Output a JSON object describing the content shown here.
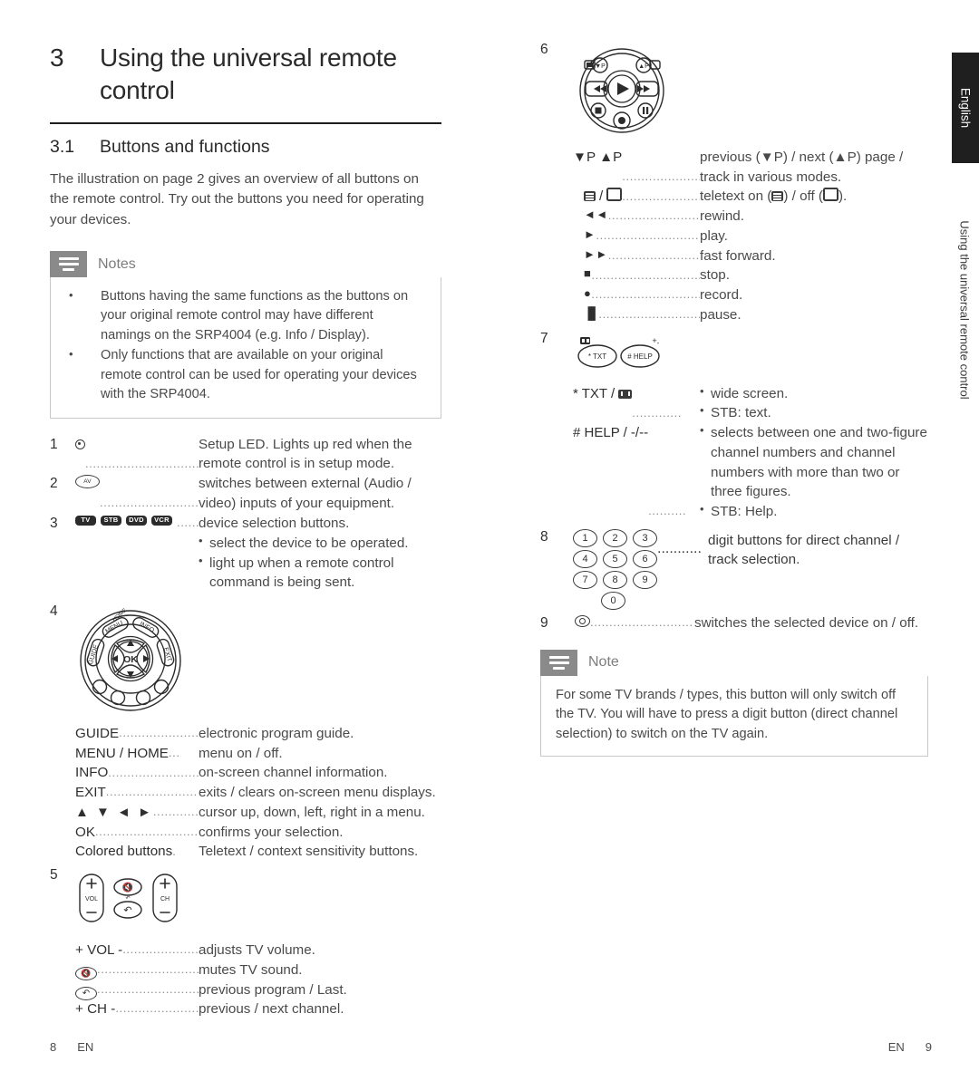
{
  "document": {
    "language_tab": "English",
    "side_caption": "Using the universal remote control"
  },
  "chapter": {
    "number": "3",
    "title": "Using the universal remote control"
  },
  "section": {
    "number": "3.1",
    "title": "Buttons and functions",
    "intro": "The illustration on page 2 gives an overview of all buttons on the remote control. Try out the buttons you need for operating your devices."
  },
  "notes_box": {
    "title": "Notes",
    "items": [
      "Buttons having the same functions as the buttons on your original remote control may have different namings on the SRP4004 (e.g. Info / Display).",
      "Only functions that are available on your original remote control can be used for operating your devices with the SRP4004."
    ]
  },
  "note_box": {
    "title": "Note",
    "text": "For some TV brands / types, this button will only switch off the TV. You will have to press a digit button (direct channel selection) to switch on the TV again."
  },
  "entries": {
    "item1": {
      "index": "1",
      "icon": "setup-led-icon",
      "description": "Setup LED. Lights up red when the remote control is in setup mode."
    },
    "item2": {
      "index": "2",
      "key_label": "AV",
      "description": "switches between external (Audio / video) inputs of your equipment."
    },
    "item3": {
      "index": "3",
      "device_buttons": [
        "TV",
        "STB",
        "DVD",
        "VCR"
      ],
      "description": "device selection buttons.",
      "bullets": [
        "select the device to be operated.",
        "light up when a remote control command is being sent."
      ]
    },
    "item4": {
      "index": "4",
      "pad_labels": [
        "HOME",
        "MENU",
        "INFO",
        "GUIDE",
        "EXIT",
        "OK"
      ],
      "rows": [
        {
          "key": "GUIDE",
          "desc": "electronic program guide."
        },
        {
          "key": "MENU / HOME",
          "desc": "menu on / off."
        },
        {
          "key": "INFO",
          "desc": "on-screen channel information."
        },
        {
          "key": "EXIT",
          "desc": "exits / clears on-screen menu displays."
        },
        {
          "key": "▲ ▼ ◄ ►",
          "desc": "cursor up, down, left, right in a menu."
        },
        {
          "key": "OK",
          "desc": "confirms your selection."
        },
        {
          "key": "Colored buttons",
          "desc": "Teletext / context sensitivity buttons."
        }
      ]
    },
    "item5": {
      "index": "5",
      "pad_labels": [
        "+",
        "VOL",
        "−",
        "+",
        "CH",
        "−"
      ],
      "rows": [
        {
          "key": "+ VOL -",
          "desc": "adjusts TV volume."
        },
        {
          "key": "mute-icon",
          "desc": "mutes TV sound."
        },
        {
          "key": "last-channel-icon",
          "desc": "previous program / Last."
        },
        {
          "key": "+ CH -",
          "desc": "previous / next channel."
        }
      ]
    },
    "item6": {
      "index": "6",
      "rows": [
        {
          "key": "▼P ▲P",
          "desc": "previous (▼P) / next (▲P) page / track in various modes."
        },
        {
          "key": "teletext-on-icon / teletext-off-icon",
          "desc_pre": "teletext on (",
          "desc_mid": ") / off (",
          "desc_post": ")."
        },
        {
          "key": "◄◄",
          "desc": "rewind."
        },
        {
          "key": "►",
          "desc": "play."
        },
        {
          "key": "►►",
          "desc": "fast forward."
        },
        {
          "key": "■",
          "desc": "stop."
        },
        {
          "key": "●",
          "desc": "record."
        },
        {
          "key": "▐▌",
          "desc": "pause."
        }
      ]
    },
    "item7": {
      "index": "7",
      "buttons": [
        "* TXT",
        "# HELP"
      ],
      "rows": [
        {
          "key_pre": "* TXT / ",
          "key_icon": "wide-screen-icon",
          "bullets": [
            "wide screen.",
            "STB: text."
          ]
        },
        {
          "key": "# HELP / -/--",
          "bullets": [
            "selects between one and two-figure channel numbers and channel numbers with more than two or three figures.",
            "STB: Help."
          ]
        }
      ]
    },
    "item8": {
      "index": "8",
      "digits": [
        [
          "1",
          "2",
          "3"
        ],
        [
          "4",
          "5",
          "6"
        ],
        [
          "7",
          "8",
          "9"
        ],
        [
          "0"
        ]
      ],
      "description": "digit buttons for direct channel / track selection."
    },
    "item9": {
      "index": "9",
      "icon": "power-icon",
      "description": "switches the selected device on / off."
    }
  },
  "footer": {
    "left_page": "8",
    "left_lang": "EN",
    "right_lang": "EN",
    "right_page": "9"
  },
  "colors": {
    "tab_background": "#1f1f1f",
    "note_icon": "#8a8a8a",
    "rule": "#1d1d1d",
    "body_text": "#4a4a4a"
  }
}
